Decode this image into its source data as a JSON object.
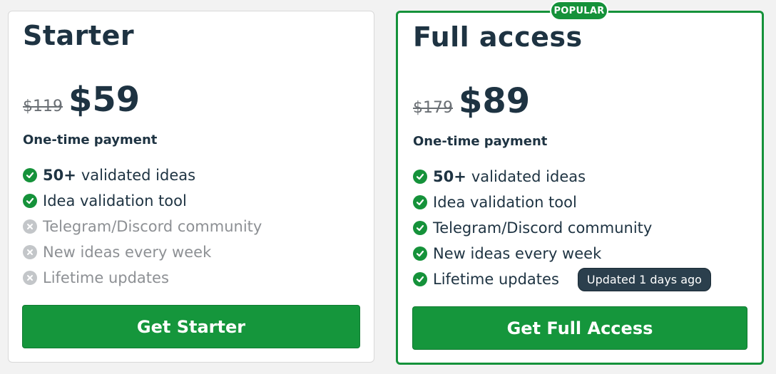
{
  "plans": [
    {
      "title": "Starter",
      "old_price": "$119",
      "price": "$59",
      "payment": "One-time payment",
      "features": [
        {
          "bold": "50+",
          "text": "validated ideas",
          "included": true,
          "icon": "check-circle-icon"
        },
        {
          "bold": "",
          "text": "Idea validation tool",
          "included": true,
          "icon": "check-circle-icon"
        },
        {
          "bold": "",
          "text": "Telegram/Discord community",
          "included": false,
          "icon": "x-circle-icon"
        },
        {
          "bold": "",
          "text": "New ideas every week",
          "included": false,
          "icon": "x-circle-icon"
        },
        {
          "bold": "",
          "text": "Lifetime updates",
          "included": false,
          "icon": "x-circle-icon"
        }
      ],
      "cta": "Get Starter"
    },
    {
      "badge": "POPULAR",
      "title": "Full access",
      "old_price": "$179",
      "price": "$89",
      "payment": "One-time payment",
      "features": [
        {
          "bold": "50+",
          "text": "validated ideas",
          "included": true,
          "icon": "check-circle-icon"
        },
        {
          "bold": "",
          "text": "Idea validation tool",
          "included": true,
          "icon": "check-circle-icon"
        },
        {
          "bold": "",
          "text": "Telegram/Discord community",
          "included": true,
          "icon": "check-circle-icon"
        },
        {
          "bold": "",
          "text": "New ideas every week",
          "included": true,
          "icon": "check-circle-icon"
        },
        {
          "bold": "",
          "text": "Lifetime updates",
          "included": true,
          "icon": "check-circle-icon"
        }
      ],
      "updated_badge": "Updated 1 days ago",
      "cta": "Get Full Access"
    }
  ],
  "colors": {
    "accent_green": "#15963c",
    "text_dark": "#1e3342",
    "muted_gray": "#8d9094",
    "badge_dark": "#2b3f4d"
  }
}
